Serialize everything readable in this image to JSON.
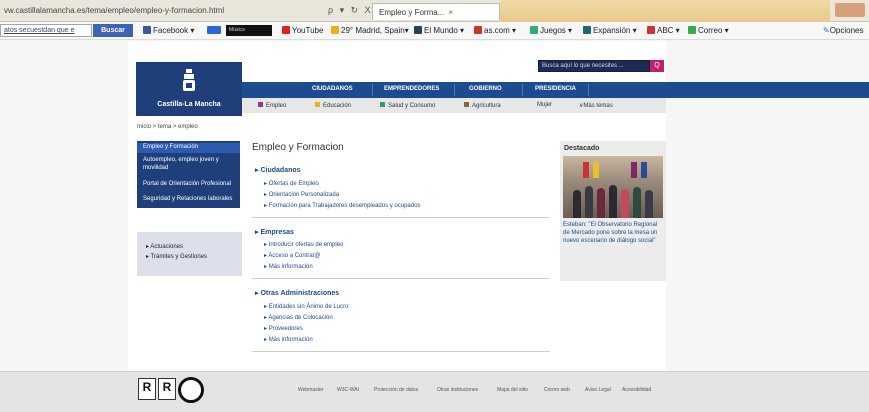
{
  "browser": {
    "url": "vw.castillalamancha.es/tema/empleo/empleo-y-formacion.html",
    "tab_title": "Empleo y Forma...",
    "controls": "ρ ▾ ↻ X"
  },
  "favbar": {
    "search_value": "atos secuestdan que e",
    "search_button": "Buscar",
    "box_label": "Música",
    "items": [
      "Facebook ▾",
      "YouTube",
      "29° Madrid, Spain▾",
      "El Mundo ▾",
      "as.com ▾",
      "Juegos ▾",
      "Expansión ▾",
      "ABC ▾",
      "Correo ▾"
    ],
    "options": "Opciones"
  },
  "site": {
    "logo_name": "Castilla-La Mancha",
    "search_placeholder": "Busca aquí lo que necesites ...",
    "search_btn": "Q",
    "nav": [
      "CIUDADANOS",
      "EMPRENDEDORES",
      "GOBIERNO",
      "PRESIDENCIA"
    ],
    "subnav": [
      {
        "label": "Empleo",
        "color": "#8b3a8f"
      },
      {
        "label": "Educación",
        "color": "#e8b41a"
      },
      {
        "label": "Salud y Consumo",
        "color": "#2f9b6a"
      },
      {
        "label": "Agricultura",
        "color": "#7d6c3a"
      },
      {
        "label": "Mujer",
        "color": "#c03a76"
      },
      {
        "label": "Más temas",
        "color": ""
      }
    ],
    "breadcrumb": "Inicio > tema > empleo"
  },
  "sidebar": {
    "items": [
      "Empleo y Formación",
      "Autoempleo, empleo joven y movilidad",
      "Portal de Orientación Profesional",
      "Seguridad y Relaciones laborales"
    ],
    "box": [
      "Actuaciones",
      "Trámites y Gestiones"
    ]
  },
  "main": {
    "title": "Empleo y Formacion",
    "sections": [
      {
        "title": "Ciudadanos",
        "links": [
          "Ofertas de Empleo",
          "Orientación Personalizada",
          "Formación para Trabajadores desempleados y ocupados"
        ]
      },
      {
        "title": "Empresas",
        "links": [
          "Introducir ofertas de empleo",
          "Acceso a Contrat@",
          "Más información"
        ]
      },
      {
        "title": "Otras Administraciones",
        "links": [
          "Entidades sin Ánimo de Lucro",
          "Agencias de Colocación",
          "Proveedores",
          "Más información"
        ]
      }
    ]
  },
  "destacado": {
    "title": "Destacado",
    "text": "Esteban: \"El Observatorio Regional de Mercado pone sobre la mesa un nuevo escenario de diálogo social\""
  },
  "footer": {
    "links": [
      "Webmaster",
      "W3C-WAI",
      "Protección de datos",
      "Otras instituciones",
      "Mapa del sitio",
      "Correo web",
      "Aviso Legal",
      "Accesibilidad"
    ]
  }
}
